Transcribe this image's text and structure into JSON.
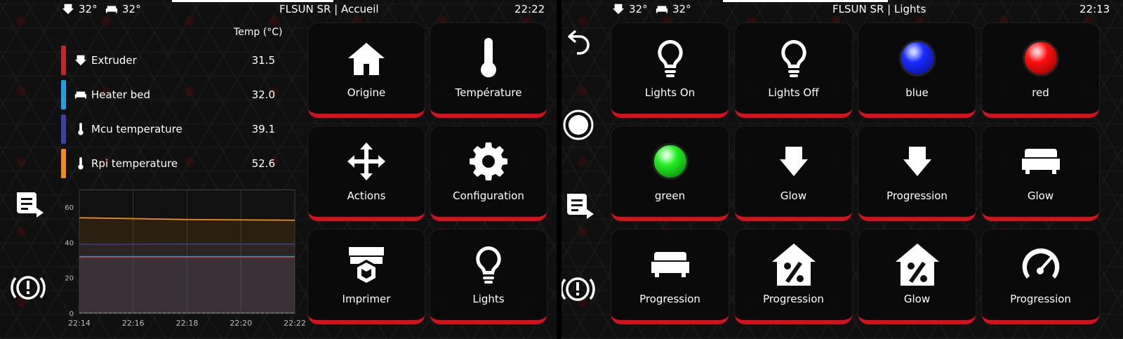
{
  "left": {
    "topbar": {
      "extruder_temp": "32°",
      "bed_temp": "32°",
      "title": "FLSUN SR | Accueil",
      "clock": "22:22"
    },
    "temps": {
      "header": "Temp (°C)",
      "rows": [
        {
          "name": "Extruder",
          "value": "31.5",
          "color": "#c0262c",
          "icon": "extruder-icon"
        },
        {
          "name": "Heater bed",
          "value": "32.0",
          "color": "#1aa3e8",
          "icon": "bed-icon"
        },
        {
          "name": "Mcu temperature",
          "value": "39.1",
          "color": "#3b3fa6",
          "icon": "thermometer-icon"
        },
        {
          "name": "Rpi temperature",
          "value": "52.6",
          "color": "#f28c12",
          "icon": "thermometer-icon"
        }
      ]
    },
    "chart_data": {
      "type": "line",
      "x": [
        "22:14",
        "22:16",
        "22:18",
        "22:20",
        "22:22"
      ],
      "yticks": [
        0,
        20,
        40,
        60
      ],
      "ylim": [
        0,
        70
      ],
      "grid": true,
      "series": [
        {
          "values": [
            54,
            53.5,
            53,
            52.8,
            52.6
          ],
          "color": "#f28c12"
        },
        {
          "values": [
            39,
            39,
            39.1,
            39.1,
            39.1
          ],
          "color": "#3b3fa6"
        },
        {
          "values": [
            32,
            32,
            32,
            32,
            32.0
          ],
          "color": "#1aa3e8"
        },
        {
          "values": [
            31.5,
            31.5,
            31.5,
            31.5,
            31.5
          ],
          "color": "#c0262c"
        }
      ]
    },
    "buttons": [
      {
        "label": "Origine",
        "icon": "home-icon"
      },
      {
        "label": "Température",
        "icon": "thermometer-icon"
      },
      {
        "label": "Actions",
        "icon": "move-arrows-icon"
      },
      {
        "label": "Configuration",
        "icon": "gear-icon"
      },
      {
        "label": "Imprimer",
        "icon": "printer-icon"
      },
      {
        "label": "Lights",
        "icon": "lightbulb-icon"
      }
    ]
  },
  "right": {
    "topbar": {
      "extruder_temp": "32°",
      "bed_temp": "32°",
      "title": "FLSUN SR | Lights",
      "clock": "22:13"
    },
    "buttons": [
      {
        "label": "Lights On",
        "icon": "lightbulb-icon"
      },
      {
        "label": "Lights Off",
        "icon": "lightbulb-icon"
      },
      {
        "label": "blue",
        "icon": "blue-ball-icon",
        "color": "#1a2cff"
      },
      {
        "label": "red",
        "icon": "red-ball-icon",
        "color": "#ff1010"
      },
      {
        "label": "green",
        "icon": "green-ball-icon",
        "color": "#22ee22"
      },
      {
        "label": "Glow",
        "icon": "extruder-icon"
      },
      {
        "label": "Progression",
        "icon": "extruder-icon"
      },
      {
        "label": "Glow",
        "icon": "bed-icon"
      },
      {
        "label": "Progression",
        "icon": "bed-icon"
      },
      {
        "label": "Progression",
        "icon": "percent-house-icon"
      },
      {
        "label": "Glow",
        "icon": "percent-house-icon"
      },
      {
        "label": "Progression",
        "icon": "speed-gauge-icon"
      }
    ]
  }
}
